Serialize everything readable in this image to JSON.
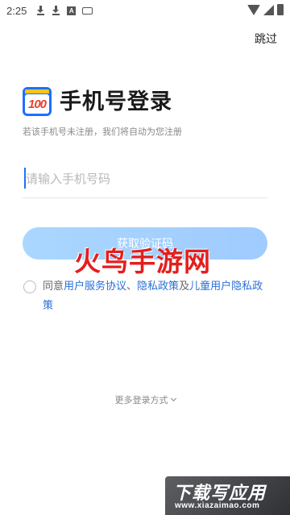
{
  "status_bar": {
    "time": "2:25",
    "icons": [
      "download-icon",
      "download-icon",
      "a-notification-icon",
      "keyboard-icon",
      "wifi-icon",
      "signal-icon",
      "battery-icon"
    ],
    "a_glyph": "A"
  },
  "header": {
    "skip_label": "跳过"
  },
  "logo": {
    "text": "100",
    "colors": {
      "frame": "#1e6fff",
      "tab": "#ffc21a",
      "digits": "#e8402c"
    }
  },
  "login": {
    "title": "手机号登录",
    "subtitle": "若该手机号未注册，我们将自动为您注册",
    "phone_placeholder": "请输入手机号码",
    "phone_value": "",
    "code_button_label": "获取验证码",
    "agreement": {
      "prefix": "同意",
      "user_agreement": "用户服务协议",
      "separator": "、",
      "privacy_policy": "隐私政策",
      "conjunction": "及",
      "child_privacy_policy": "儿童用户隐私政策",
      "checked": false
    },
    "more_login_label": "更多登录方式"
  },
  "watermarks": {
    "center": "火鸟手游网",
    "bottom_title": "下载写应用",
    "bottom_url": "www.xiazaimao.com"
  },
  "colors": {
    "accent": "#1e6fff",
    "button_bg": "#a9d7ff",
    "link": "#2a6fd6",
    "watermark_red": "#e41e1e"
  }
}
